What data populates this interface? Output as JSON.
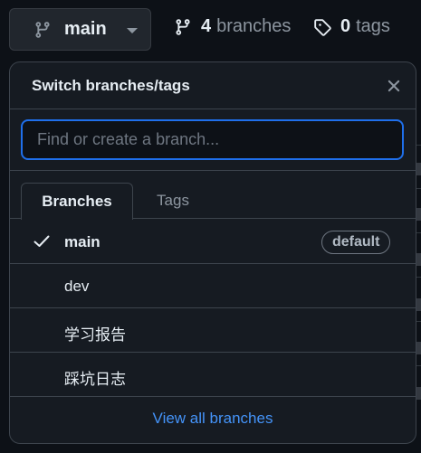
{
  "header": {
    "branch_button": {
      "label": "main",
      "icon": "git-branch-icon",
      "caret": "triangle-down-icon"
    },
    "branches_stat": {
      "count": "4",
      "label": "branches",
      "icon": "git-branch-icon"
    },
    "tags_stat": {
      "count": "0",
      "label": "tags",
      "icon": "tag-icon"
    }
  },
  "popover": {
    "title": "Switch branches/tags",
    "close_icon": "x-icon",
    "search": {
      "placeholder": "Find or create a branch...",
      "value": ""
    },
    "tabs": [
      {
        "label": "Branches",
        "selected": true
      },
      {
        "label": "Tags",
        "selected": false
      }
    ],
    "branches": [
      {
        "name": "main",
        "selected": true,
        "badge": "default"
      },
      {
        "name": "dev",
        "selected": false,
        "badge": ""
      },
      {
        "name": "学习报告",
        "selected": false,
        "badge": ""
      },
      {
        "name": "踩坑日志",
        "selected": false,
        "badge": ""
      }
    ],
    "footer_link": "View all branches"
  },
  "colors": {
    "background": "#0d1117",
    "popover_bg": "#161b22",
    "border": "#3d444d",
    "accent_link": "#4493f8",
    "focus_ring": "#1f6feb"
  }
}
